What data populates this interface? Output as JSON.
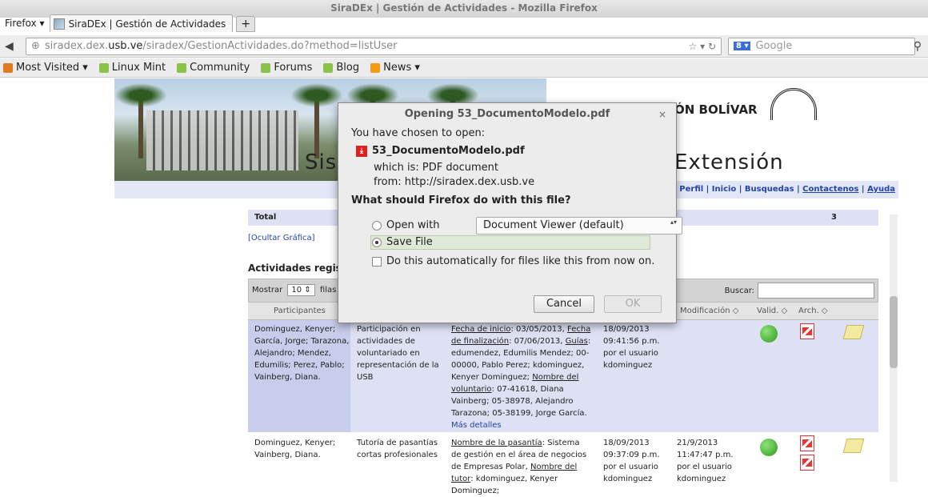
{
  "window": {
    "title": "SiraDEx | Gestión de Actividades - Mozilla Firefox"
  },
  "tabs": {
    "firefox_menu": "Firefox ▾",
    "active_tab": "SiraDEx | Gestión de Actividades",
    "new_tab_symbol": "+"
  },
  "nav": {
    "url_prefix": "siradex.dex.",
    "url_domain": "usb.ve",
    "url_path": "/siradex/GestionActividades.do?method=listUser",
    "url_right_icons": "☆ ▾ ↻",
    "search_placeholder": "Google",
    "search_engine": "8 ▾"
  },
  "bookmarks": [
    {
      "label": "Most Visited ▾",
      "icon": "most-visited"
    },
    {
      "label": "Linux Mint",
      "icon": "bookmark"
    },
    {
      "label": "Community",
      "icon": "bookmark"
    },
    {
      "label": "Forums",
      "icon": "bookmark"
    },
    {
      "label": "Blog",
      "icon": "bookmark"
    },
    {
      "label": "News ▾",
      "icon": "rss"
    }
  ],
  "banner": {
    "title_left": "Sist",
    "title_right": "Extensión",
    "university": "ÓN BOLÍVAR"
  },
  "menu": {
    "prefix": "n) | Ver Perfil | Inicio | Busquedas |",
    "contact": "Contactenos",
    "sep": "|",
    "help": "Ayuda"
  },
  "content": {
    "total_label": "Total",
    "total_value": "3",
    "hide_chart": "[Ocultar Gráfica]",
    "registered_title": "Actividades registra",
    "show_label": "Mostrar",
    "show_value": "10",
    "rows_label": "filas",
    "search_label": "Buscar:",
    "headers": {
      "participants": "Participantes",
      "modification": "Modificación ◇",
      "valid": "Valid. ◇",
      "arch": "Arch. ◇"
    },
    "rows": [
      {
        "participants": "Dominguez, Kenyer; García, Jorge; Tarazona, Alejandro; Mendez, Edumilis; Perez, Pablo; Vainberg, Diana.",
        "activity": "Participación en actividades de voluntariado en representación de la USB",
        "detail_l1": "Fecha de inicio",
        "detail_l1v": ": 03/05/2013, ",
        "detail_l2": "Fecha de finalización",
        "detail_l2v": ": 07/06/2013, ",
        "detail_l3": "Guías",
        "detail_l3v": ": edumendez, Edumilis Mendez; 00-00000, Pablo Perez; kdominguez, Kenyer Dominguez; ",
        "detail_l4": "Nombre del voluntario",
        "detail_l4v": ": 07-41618, Diana Vainberg; 05-38978, Alejandro Tarazona; 05-38199, Jorge García.",
        "more": "Más detalles",
        "created": "18/09/2013 09:41:56 p.m. por el usuario kdominguez",
        "modified": ""
      },
      {
        "participants": "Dominguez, Kenyer; Vainberg, Diana.",
        "activity": "Tutoría de pasantías cortas profesionales",
        "detail_l1": "Nombre de la pasantía",
        "detail_l1v": ": Sistema de gestión en el área de negocios de Empresas Polar, ",
        "detail_l2": "Nombre del tutor",
        "detail_l2v": ": kdominguez, Kenyer Dominguez;",
        "created": "18/09/2013 09:37:09 p.m. por el usuario kdominguez",
        "modified": "21/9/2013 11:47:47 p.m. por el usuario kdominguez"
      }
    ]
  },
  "dialog": {
    "title": "Opening 53_DocumentoModelo.pdf",
    "close": "×",
    "chosen": "You have chosen to open:",
    "filename": "53_DocumentoModelo.pdf",
    "which_is": "which is:  PDF document",
    "from": "from:  http://siradex.dex.usb.ve",
    "question": "What should Firefox do with this file?",
    "open_with": "Open with",
    "open_with_app": "Document Viewer (default)",
    "save_file": "Save File",
    "auto": "Do this automatically for files like this from now on.",
    "cancel": "Cancel",
    "ok": "OK"
  }
}
